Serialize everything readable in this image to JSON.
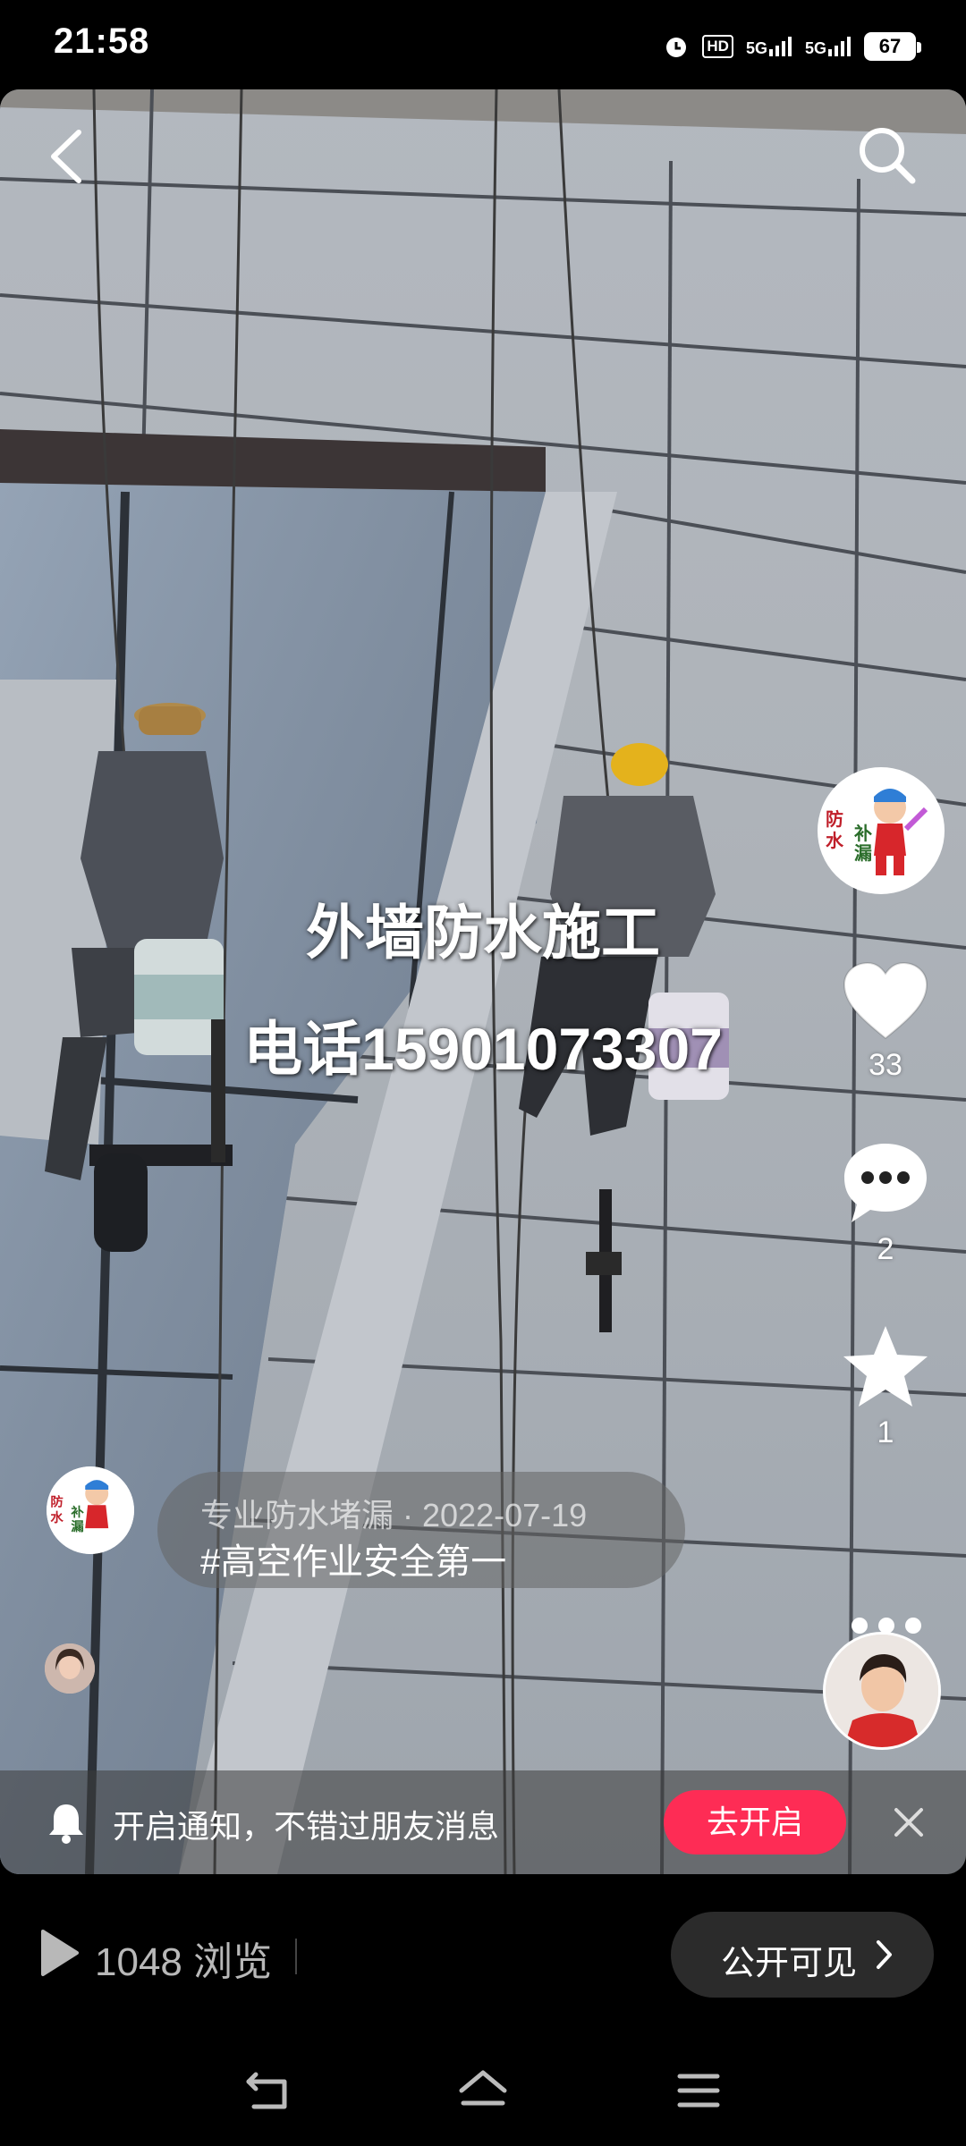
{
  "status_bar": {
    "time": "21:58",
    "network_1": "5G",
    "network_2": "5G",
    "hd_label": "HD",
    "battery": "67"
  },
  "video": {
    "overlay_title": "外墙防水施工",
    "overlay_phone": "电话15901073307"
  },
  "actions": {
    "likes": "33",
    "comments": "2",
    "favorites": "1"
  },
  "author": {
    "name": "专业防水堵漏",
    "date": "2022-07-19",
    "separator": " · ",
    "hashtag": "#高空作业安全第一",
    "logo_text": "防水补漏"
  },
  "notify_bar": {
    "text": "开启通知，不错过朋友消息",
    "button": "去开启"
  },
  "bottom_bar": {
    "views": "1048 浏览",
    "visibility": "公开可见"
  },
  "icons": [
    "back-icon",
    "search-icon",
    "heart-icon",
    "comment-icon",
    "star-icon",
    "more-icon",
    "bell-icon",
    "close-icon",
    "play-icon",
    "chevron-right-icon",
    "nav-back-icon",
    "nav-home-icon",
    "nav-menu-icon"
  ]
}
